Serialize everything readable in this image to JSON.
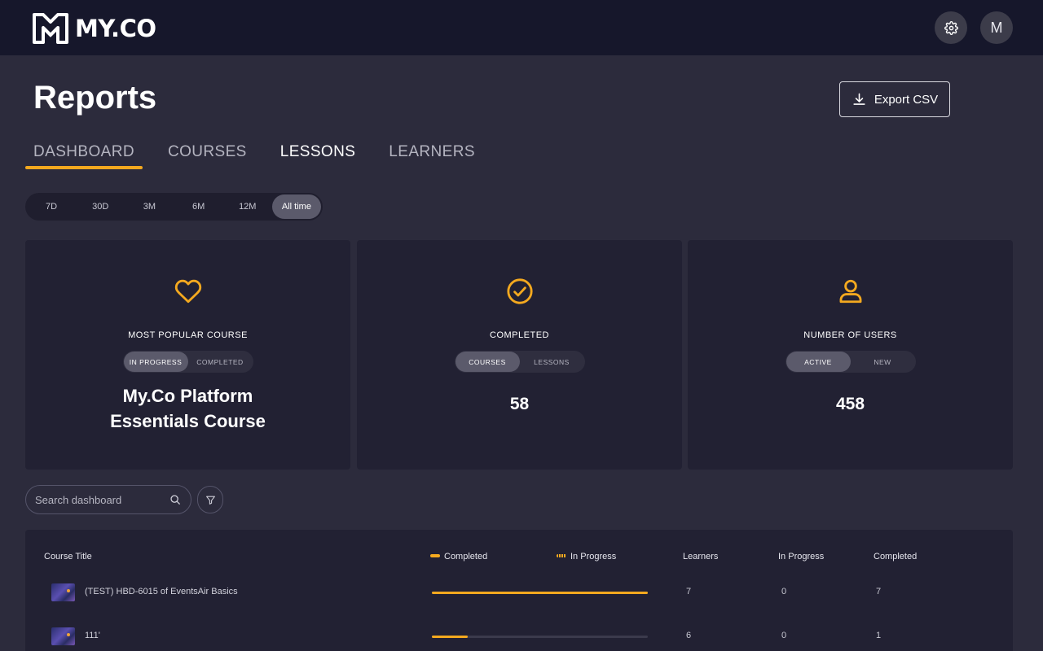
{
  "brand": {
    "name": "MY.CO",
    "accent": "#f4a91f"
  },
  "header": {
    "avatar_initial": "M",
    "settings_icon": "gear-icon"
  },
  "page": {
    "title": "Reports",
    "export_label": "Export CSV"
  },
  "tabs": [
    {
      "label": "DASHBOARD"
    },
    {
      "label": "COURSES"
    },
    {
      "label": "LESSONS"
    },
    {
      "label": "LEARNERS"
    }
  ],
  "ranges": [
    "7D",
    "30D",
    "3M",
    "6M",
    "12M",
    "All time"
  ],
  "cards": {
    "popular": {
      "label": "MOST POPULAR COURSE",
      "opt1": "IN PROGRESS",
      "opt2": "COMPLETED",
      "course_line1": "My.Co Platform",
      "course_line2": "Essentials Course"
    },
    "completed": {
      "label": "COMPLETED",
      "opt1": "COURSES",
      "opt2": "LESSONS",
      "value": "58"
    },
    "users": {
      "label": "NUMBER OF USERS",
      "opt1": "ACTIVE",
      "opt2": "NEW",
      "value": "458"
    }
  },
  "search": {
    "placeholder": "Search dashboard"
  },
  "table": {
    "headers": {
      "title": "Course Title",
      "completed_legend": "Completed",
      "progress_legend": "In Progress",
      "learners": "Learners",
      "in_progress": "In Progress",
      "completed": "Completed"
    },
    "rows": [
      {
        "title": "(TEST) HBD-6015 of EventsAir Basics",
        "completion": 1.0,
        "learners": "7",
        "in_progress": "0",
        "completed": "7"
      },
      {
        "title": "111'",
        "completion": 0.167,
        "learners": "6",
        "in_progress": "0",
        "completed": "1"
      }
    ]
  }
}
